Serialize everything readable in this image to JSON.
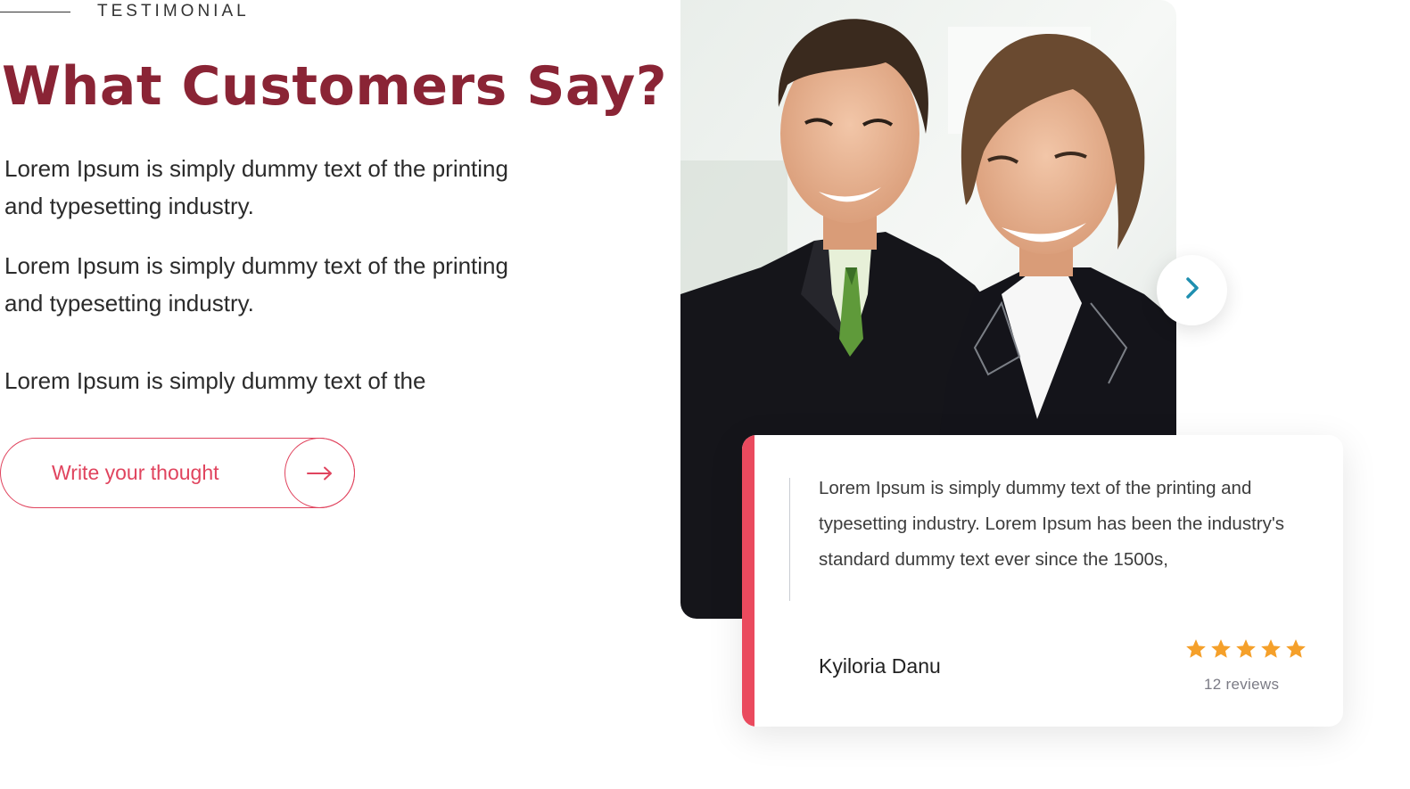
{
  "section": {
    "eyebrow": "TESTIMONIAL",
    "title": "What Customers Say?",
    "paragraphs": [
      "Lorem Ipsum is simply dummy text of the printing and typesetting industry.",
      "Lorem Ipsum is simply dummy text of the printing and typesetting industry.",
      "Lorem Ipsum is simply dummy text of the"
    ],
    "cta_label": "Write your thought"
  },
  "testimonial": {
    "quote": "Lorem Ipsum is simply dummy text of the printing and typesetting industry. Lorem Ipsum has been the industry's standard dummy text ever since the 1500s,",
    "reviewer": "Kyiloria Danu",
    "rating": 5,
    "reviews_label": "12 reviews"
  },
  "icons": {
    "cta": "arrow-right-icon",
    "next": "chevron-right-icon",
    "rating": "star-icon"
  },
  "colors": {
    "title": "#8a2435",
    "accent": "#ea4a5e",
    "star": "#f5a02a",
    "chevron": "#1f8fb0"
  }
}
